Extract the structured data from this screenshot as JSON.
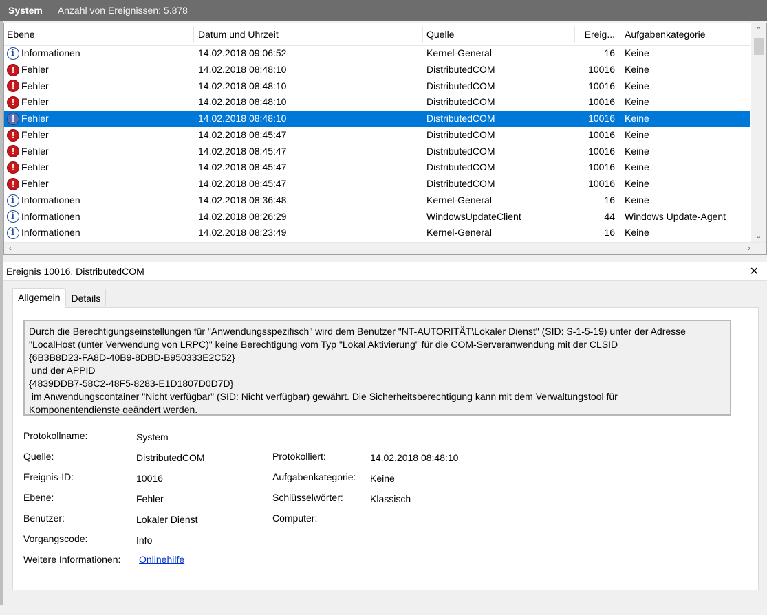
{
  "titlebar": {
    "log_name": "System",
    "count_text": "Anzahl von Ereignissen: 5.878"
  },
  "columns": {
    "level": "Ebene",
    "date": "Datum und Uhrzeit",
    "source": "Quelle",
    "id": "Ereig...",
    "category": "Aufgabenkategorie"
  },
  "events": [
    {
      "level": "Informationen",
      "type": "info",
      "date": "14.02.2018 09:06:52",
      "source": "Kernel-General",
      "id": "16",
      "category": "Keine"
    },
    {
      "level": "Fehler",
      "type": "error",
      "date": "14.02.2018 08:48:10",
      "source": "DistributedCOM",
      "id": "10016",
      "category": "Keine"
    },
    {
      "level": "Fehler",
      "type": "error",
      "date": "14.02.2018 08:48:10",
      "source": "DistributedCOM",
      "id": "10016",
      "category": "Keine"
    },
    {
      "level": "Fehler",
      "type": "error",
      "date": "14.02.2018 08:48:10",
      "source": "DistributedCOM",
      "id": "10016",
      "category": "Keine"
    },
    {
      "level": "Fehler",
      "type": "error",
      "date": "14.02.2018 08:48:10",
      "source": "DistributedCOM",
      "id": "10016",
      "category": "Keine",
      "selected": true
    },
    {
      "level": "Fehler",
      "type": "error",
      "date": "14.02.2018 08:45:47",
      "source": "DistributedCOM",
      "id": "10016",
      "category": "Keine"
    },
    {
      "level": "Fehler",
      "type": "error",
      "date": "14.02.2018 08:45:47",
      "source": "DistributedCOM",
      "id": "10016",
      "category": "Keine"
    },
    {
      "level": "Fehler",
      "type": "error",
      "date": "14.02.2018 08:45:47",
      "source": "DistributedCOM",
      "id": "10016",
      "category": "Keine"
    },
    {
      "level": "Fehler",
      "type": "error",
      "date": "14.02.2018 08:45:47",
      "source": "DistributedCOM",
      "id": "10016",
      "category": "Keine"
    },
    {
      "level": "Informationen",
      "type": "info",
      "date": "14.02.2018 08:36:48",
      "source": "Kernel-General",
      "id": "16",
      "category": "Keine"
    },
    {
      "level": "Informationen",
      "type": "info",
      "date": "14.02.2018 08:26:29",
      "source": "WindowsUpdateClient",
      "id": "44",
      "category": "Windows Update-Agent"
    },
    {
      "level": "Informationen",
      "type": "info",
      "date": "14.02.2018 08:23:49",
      "source": "Kernel-General",
      "id": "16",
      "category": "Keine"
    }
  ],
  "detail": {
    "header": "Ereignis 10016, DistributedCOM",
    "tabs": [
      "Allgemein",
      "Details"
    ],
    "description_lines": [
      "Durch die Berechtigungseinstellungen für \"Anwendungsspezifisch\" wird dem Benutzer \"NT-AUTORITÄT\\Lokaler Dienst\" (SID: S-1-5-19) unter der Adresse",
      "\"LocalHost (unter Verwendung von LRPC)\" keine Berechtigung vom Typ \"Lokal Aktivierung\" für die COM-Serveranwendung mit der CLSID",
      "{6B3B8D23-FA8D-40B9-8DBD-B950333E2C52}",
      " und der APPID",
      "{4839DDB7-58C2-48F5-8283-E1D1807D0D7D}",
      " im Anwendungscontainer \"Nicht verfügbar\" (SID: Nicht verfügbar) gewährt. Die Sicherheitsberechtigung kann mit dem Verwaltungstool für",
      "Komponentendienste geändert werden."
    ],
    "props": {
      "protokollname_label": "Protokollname:",
      "protokollname": "System",
      "quelle_label": "Quelle:",
      "quelle": "DistributedCOM",
      "protokolliert_label": "Protokolliert:",
      "protokolliert": "14.02.2018 08:48:10",
      "ereignis_id_label": "Ereignis-ID:",
      "ereignis_id": "10016",
      "aufgabenkategorie_label": "Aufgabenkategorie:",
      "aufgabenkategorie": "Keine",
      "ebene_label": "Ebene:",
      "ebene": "Fehler",
      "schluesselwoerter_label": "Schlüsselwörter:",
      "schluesselwoerter": "Klassisch",
      "benutzer_label": "Benutzer:",
      "benutzer": "Lokaler Dienst",
      "computer_label": "Computer:",
      "computer": "",
      "vorgangscode_label": "Vorgangscode:",
      "vorgangscode": "Info",
      "weitere_label": "Weitere Informationen:",
      "weitere_link": "Onlinehilfe"
    }
  }
}
